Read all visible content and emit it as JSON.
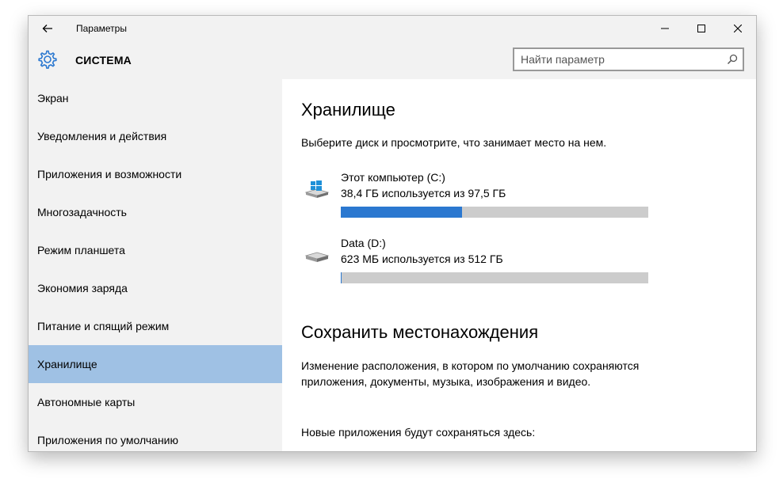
{
  "window": {
    "title": "Параметры",
    "controls": {
      "minimize_icon": "minimize-icon",
      "maximize_icon": "maximize-icon",
      "close_icon": "close-icon"
    }
  },
  "header": {
    "icon": "gear-icon",
    "title": "СИСТЕМА",
    "search_placeholder": "Найти параметр"
  },
  "sidebar": {
    "items": [
      {
        "label": "Экран"
      },
      {
        "label": "Уведомления и действия"
      },
      {
        "label": "Приложения и возможности"
      },
      {
        "label": "Многозадачность"
      },
      {
        "label": "Режим планшета"
      },
      {
        "label": "Экономия заряда"
      },
      {
        "label": "Питание и спящий режим"
      },
      {
        "label": "Хранилище",
        "selected": true
      },
      {
        "label": "Автономные карты"
      },
      {
        "label": "Приложения по умолчанию"
      }
    ]
  },
  "main": {
    "storage_title": "Хранилище",
    "storage_desc": "Выберите диск и просмотрите, что занимает место на нем.",
    "drives": [
      {
        "name": "Этот компьютер (C:)",
        "usage": "38,4 ГБ используется из 97,5 ГБ",
        "fraction_used": 0.394,
        "icon": "windows-drive-icon"
      },
      {
        "name": "Data (D:)",
        "usage": "623 МБ используется из 512 ГБ",
        "fraction_used": 0.0012,
        "icon": "hard-drive-icon"
      }
    ],
    "save_title": "Сохранить местонахождения",
    "save_desc": "Изменение расположения, в котором по умолчанию сохраняются приложения, документы, музыка, изображения и видео.",
    "new_apps_label": "Новые приложения будут сохраняться здесь:"
  },
  "colors": {
    "accent": "#2b78d0",
    "selection": "#9fc1e4",
    "bar_track": "#cccccc",
    "pane_bg": "#f2f2f2"
  }
}
